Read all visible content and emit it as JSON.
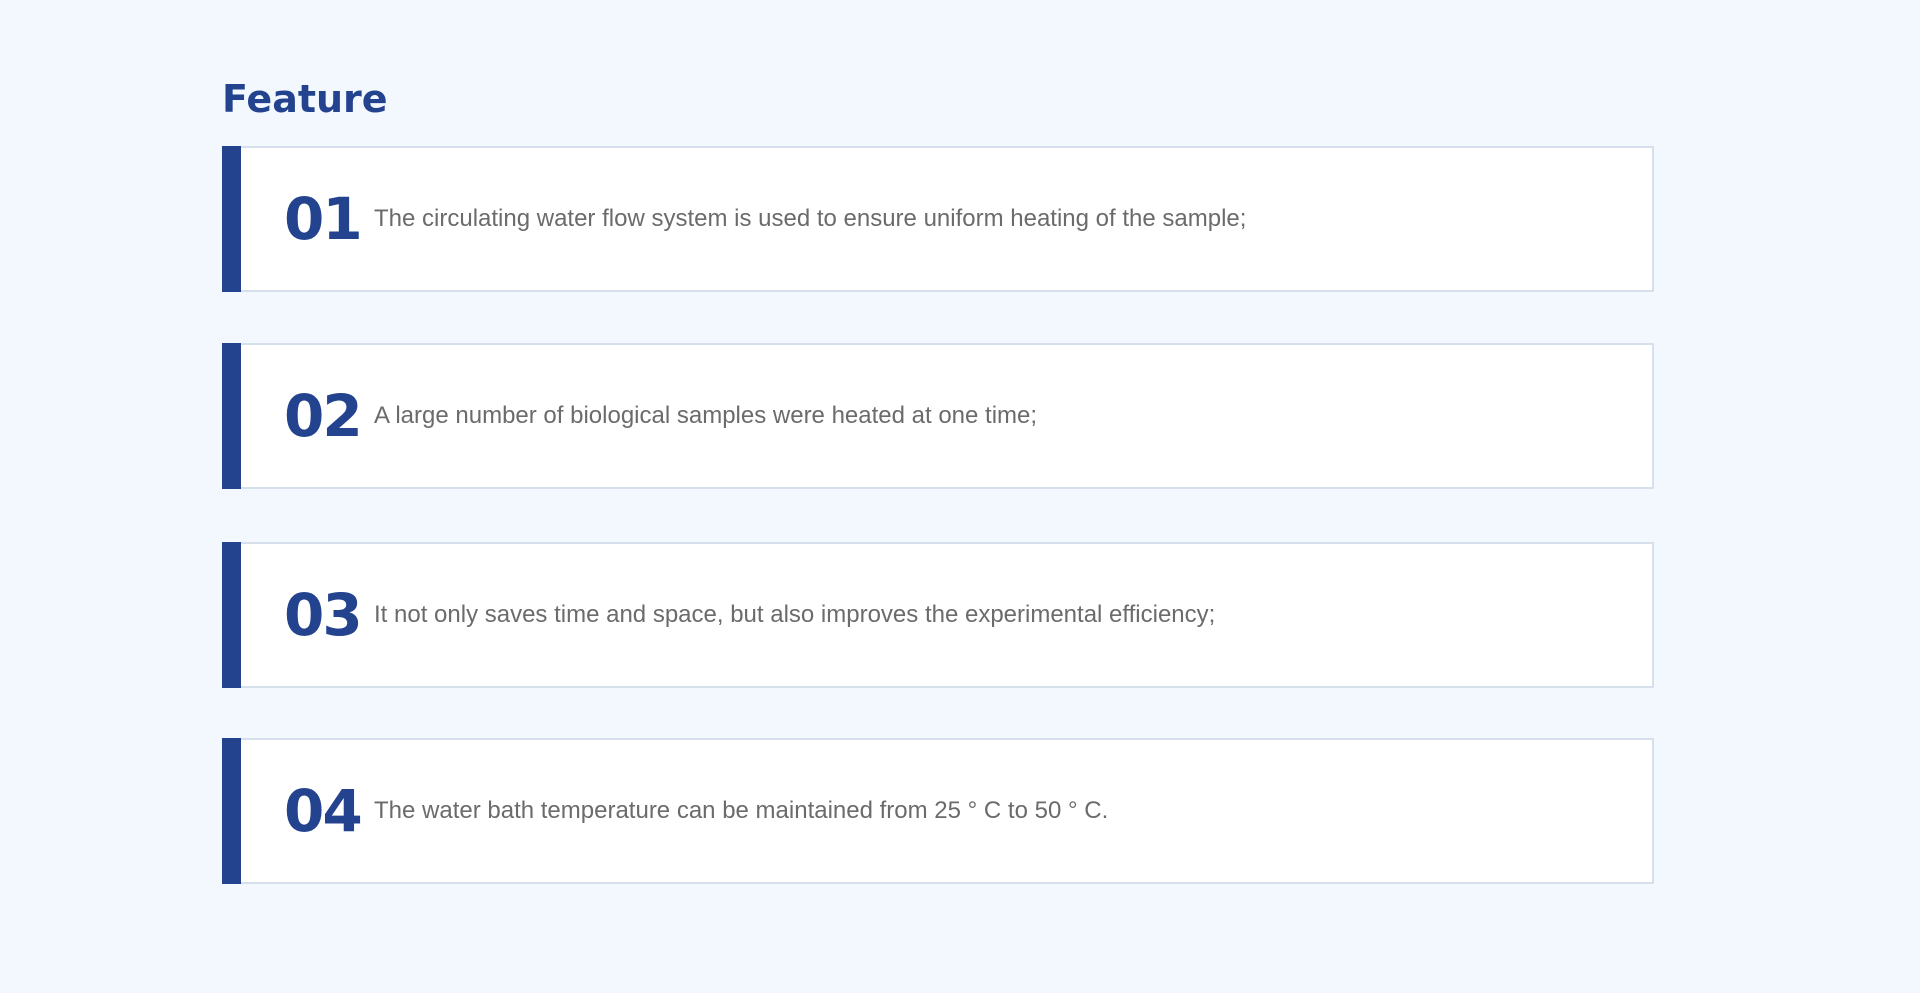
{
  "section": {
    "title": "Feature"
  },
  "features": [
    {
      "number": "01",
      "text": "The circulating water flow system is used to ensure uniform heating of the sample;"
    },
    {
      "number": "02",
      "text": "A large number of biological samples were heated at one time;"
    },
    {
      "number": "03",
      "text": "It not only saves time and space, but also improves the experimental efficiency;"
    },
    {
      "number": "04",
      "text": "The water bath temperature can be maintained from 25 ° C to 50 ° C."
    }
  ],
  "colors": {
    "accent": "#23438f",
    "background": "#f2f8fe",
    "card": "#ffffff",
    "card_border": "#d6e0ec",
    "body_text": "#6b6b6b"
  }
}
